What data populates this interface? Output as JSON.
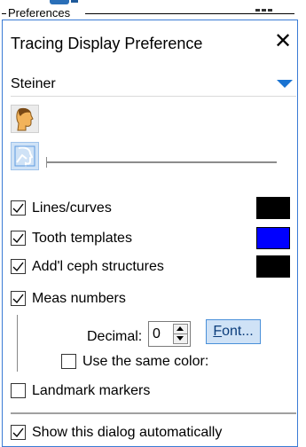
{
  "group": {
    "title": "Preferences"
  },
  "dialog": {
    "title": "Tracing Display Preference",
    "close_glyph": "✕"
  },
  "template": {
    "selected": "Steiner"
  },
  "options": {
    "lines_curves": {
      "label": "Lines/curves",
      "checked": true,
      "color": "#000000"
    },
    "tooth_templates": {
      "label": "Tooth templates",
      "checked": true,
      "color": "#0000ff"
    },
    "addl_ceph": {
      "label": "Add'l ceph structures",
      "checked": true,
      "color": "#000000"
    },
    "meas_numbers": {
      "label": "Meas numbers",
      "checked": true
    },
    "decimal": {
      "label": "Decimal:",
      "value": "0"
    },
    "font_button": {
      "label": "Font...",
      "accel": "F",
      "rest": "ont..."
    },
    "same_color": {
      "label": "Use the same color:",
      "checked": false
    },
    "landmark_markers": {
      "label": "Landmark markers",
      "checked": false
    },
    "show_dialog": {
      "label": "Show this dialog automatically",
      "checked": true
    }
  },
  "colors": {
    "accent": "#1a73d1",
    "panel_border": "#3a7bd5",
    "selected_bg": "#cfe2f6"
  }
}
